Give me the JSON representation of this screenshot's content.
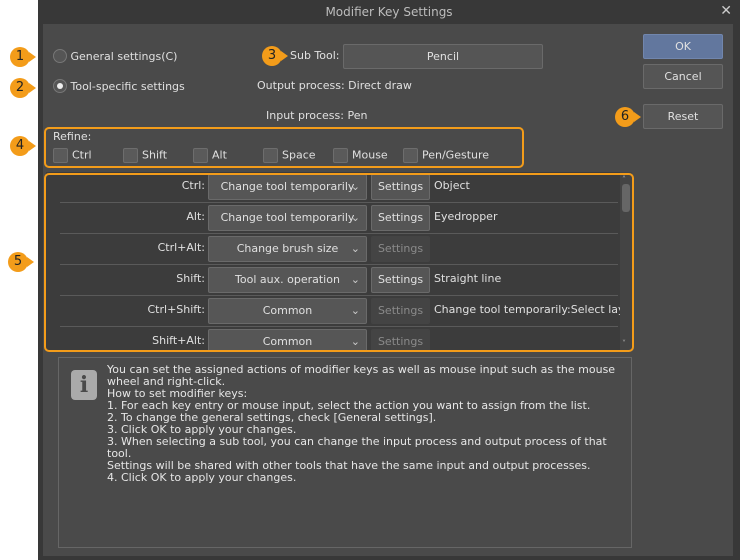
{
  "window": {
    "title": "Modifier Key Settings",
    "close": "✕"
  },
  "mode": {
    "general_label": "General settings(C)",
    "general_selected": false,
    "tool_label": "Tool-specific settings",
    "tool_selected": true
  },
  "subtool": {
    "label": "Sub Tool:",
    "value": "Pencil",
    "output_process": "Output process: Direct draw",
    "input_process": "Input process: Pen"
  },
  "buttons": {
    "ok": "OK",
    "cancel": "Cancel",
    "reset": "Reset"
  },
  "refine": {
    "label": "Refine:",
    "options": [
      {
        "label": "Ctrl",
        "checked": false
      },
      {
        "label": "Shift",
        "checked": false
      },
      {
        "label": "Alt",
        "checked": false
      },
      {
        "label": "Space",
        "checked": false
      },
      {
        "label": "Mouse",
        "checked": false
      },
      {
        "label": "Pen/Gesture",
        "checked": false
      }
    ]
  },
  "rows": [
    {
      "key": "Ctrl:",
      "action": "Change tool temporarily",
      "settings": "Settings",
      "settings_enabled": true,
      "value": "Object"
    },
    {
      "key": "Alt:",
      "action": "Change tool temporarily",
      "settings": "Settings",
      "settings_enabled": true,
      "value": "Eyedropper"
    },
    {
      "key": "Ctrl+Alt:",
      "action": "Change brush size",
      "settings": "Settings",
      "settings_enabled": false,
      "value": ""
    },
    {
      "key": "Shift:",
      "action": "Tool aux. operation",
      "settings": "Settings",
      "settings_enabled": true,
      "value": "Straight line"
    },
    {
      "key": "Ctrl+Shift:",
      "action": "Common",
      "settings": "Settings",
      "settings_enabled": false,
      "value": "Change tool temporarily:Select layer"
    },
    {
      "key": "Shift+Alt:",
      "action": "Common",
      "settings": "Settings",
      "settings_enabled": false,
      "value": ""
    }
  ],
  "info": {
    "text": "You can set the assigned actions of modifier keys as well as mouse input such as the mouse wheel and right-click.\nHow to set modifier keys:\n1. For each key entry or mouse input, select the action you want to assign from the list.\n2. To change the general settings, check [General settings].\n3. Click OK to apply your changes.\n3. When selecting a sub tool, you can change the input process and output process of that tool.\nSettings will be shared with other tools that have the same input and output processes.\n4. Click OK to apply your changes."
  },
  "callouts": [
    "1",
    "2",
    "3",
    "4",
    "5",
    "6"
  ],
  "colors": {
    "accent": "#f39c1a",
    "ok_button": "#62779e",
    "panel": "#4a4a4a"
  }
}
